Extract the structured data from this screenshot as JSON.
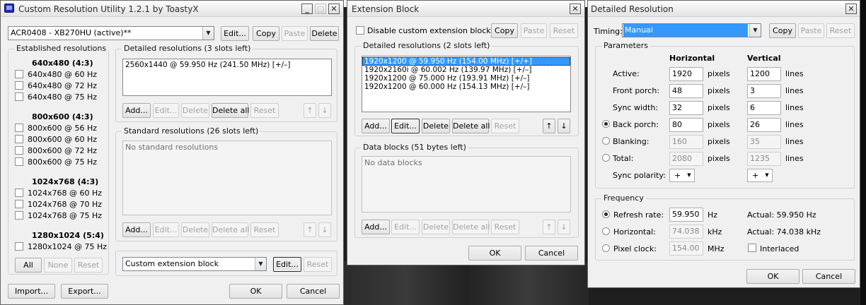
{
  "main": {
    "title": "Custom Resolution Utility 1.2.1 by ToastyX",
    "monitor": "ACR0408 - XB270HU (active)**",
    "top_buttons": {
      "edit": "Edit...",
      "copy": "Copy",
      "paste": "Paste",
      "delete": "Delete"
    },
    "established": {
      "title": "Established resolutions",
      "groups": [
        {
          "heading": "640x480 (4:3)",
          "items": [
            "640x480 @ 60 Hz",
            "640x480 @ 72 Hz",
            "640x480 @ 75 Hz"
          ]
        },
        {
          "heading": "800x600 (4:3)",
          "items": [
            "800x600 @ 56 Hz",
            "800x600 @ 60 Hz",
            "800x600 @ 72 Hz",
            "800x600 @ 75 Hz"
          ]
        },
        {
          "heading": "1024x768 (4:3)",
          "items": [
            "1024x768 @ 60 Hz",
            "1024x768 @ 70 Hz",
            "1024x768 @ 75 Hz"
          ]
        },
        {
          "heading": "1280x1024 (5:4)",
          "items": [
            "1280x1024 @ 75 Hz"
          ]
        }
      ],
      "buttons": {
        "all": "All",
        "none": "None",
        "reset": "Reset"
      }
    },
    "detailed": {
      "title": "Detailed resolutions (3 slots left)",
      "items": [
        "2560x1440 @ 59.950 Hz (241.50 MHz) [+/–]"
      ]
    },
    "standard": {
      "title": "Standard resolutions (26 slots left)",
      "empty": "No standard resolutions"
    },
    "list_buttons": {
      "add": "Add...",
      "edit": "Edit...",
      "delete": "Delete",
      "delete_all": "Delete all",
      "reset": "Reset",
      "up": "↑",
      "down": "↓"
    },
    "extension": {
      "value": "Custom extension block",
      "edit": "Edit...",
      "reset": "Reset"
    },
    "bottom": {
      "import": "Import...",
      "export": "Export...",
      "ok": "OK",
      "cancel": "Cancel"
    }
  },
  "extension_block": {
    "title": "Extension Block",
    "disable_label": "Disable custom extension block",
    "copy": "Copy",
    "paste": "Paste",
    "reset": "Reset",
    "detailed": {
      "title": "Detailed resolutions (2 slots left)",
      "items": [
        "1920x1200 @ 59.950 Hz (154.00 MHz) [+/+]",
        "1920x2160i @ 60.002 Hz (139.97 MHz) [+/–]",
        "1920x1200 @ 75.000 Hz (193.91 MHz) [+/–]",
        "1920x1200 @ 60.000 Hz (154.13 MHz) [+/–]"
      ]
    },
    "data_blocks": {
      "title": "Data blocks (51 bytes left)",
      "empty": "No data blocks"
    },
    "list_buttons": {
      "add": "Add...",
      "edit": "Edit...",
      "delete": "Delete",
      "delete_all": "Delete all",
      "reset": "Reset",
      "up": "↑",
      "down": "↓"
    },
    "ok": "OK",
    "cancel": "Cancel"
  },
  "detailed_resolution": {
    "title": "Detailed Resolution",
    "timing_label": "Timing:",
    "timing_value": "Manual",
    "copy": "Copy",
    "paste": "Paste",
    "reset": "Reset",
    "parameters": {
      "title": "Parameters",
      "col_h": "Horizontal",
      "col_v": "Vertical",
      "h_unit": "pixels",
      "v_unit": "lines",
      "rows": [
        {
          "label": "Active:",
          "h": "1920",
          "v": "1200"
        },
        {
          "label": "Front porch:",
          "h": "48",
          "v": "3"
        },
        {
          "label": "Sync width:",
          "h": "32",
          "v": "6"
        },
        {
          "label": "Back porch:",
          "h": "80",
          "v": "26"
        },
        {
          "label": "Blanking:",
          "h": "160",
          "v": "35"
        },
        {
          "label": "Total:",
          "h": "2080",
          "v": "1235"
        }
      ],
      "sync_label": "Sync polarity:",
      "sync_h": "+",
      "sync_v": "+"
    },
    "frequency": {
      "title": "Frequency",
      "refresh_label": "Refresh rate:",
      "refresh_value": "59.950",
      "refresh_unit": "Hz",
      "refresh_actual": "Actual: 59.950 Hz",
      "horizontal_label": "Horizontal:",
      "horizontal_value": "74.038",
      "horizontal_unit": "kHz",
      "horizontal_actual": "Actual: 74.038 kHz",
      "pixel_label": "Pixel clock:",
      "pixel_value": "154.00",
      "pixel_unit": "MHz",
      "interlaced": "Interlaced"
    },
    "ok": "OK",
    "cancel": "Cancel"
  }
}
